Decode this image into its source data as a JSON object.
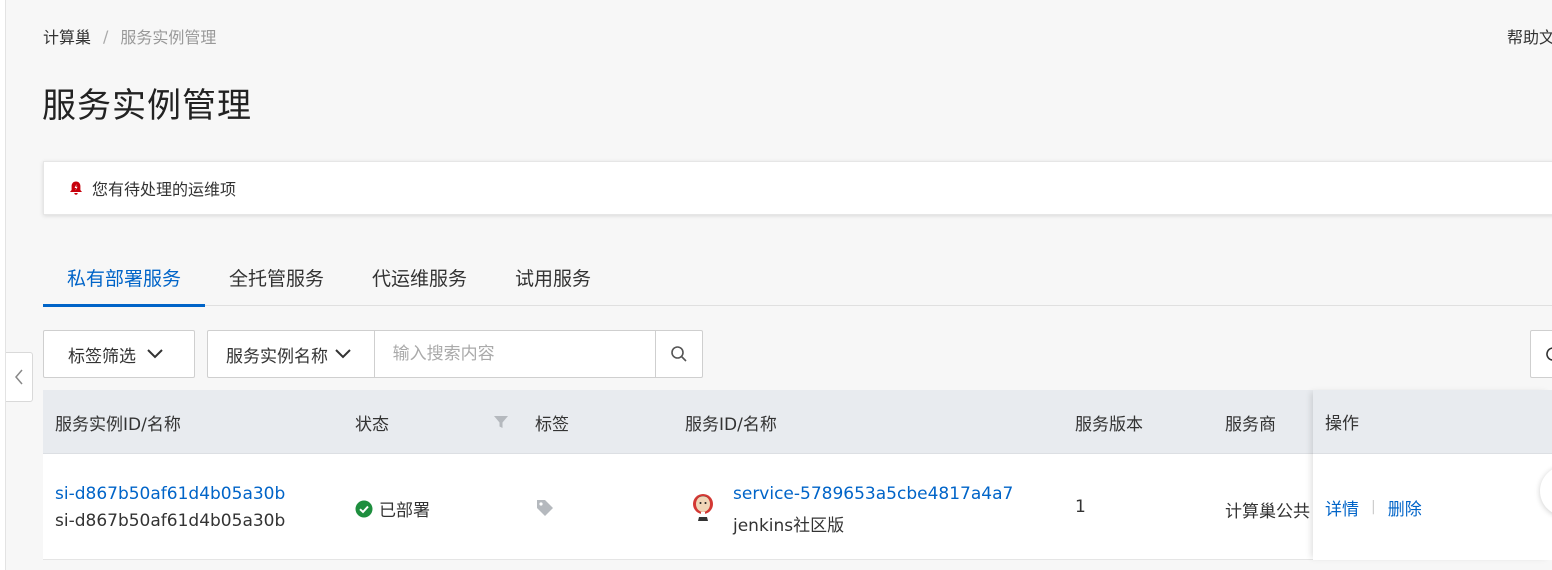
{
  "breadcrumb": {
    "root": "计算巢",
    "separator": "/",
    "current": "服务实例管理"
  },
  "header": {
    "help_text": "帮助文"
  },
  "page_title": "服务实例管理",
  "alert": {
    "text": "您有待处理的运维项",
    "icon": "bell-alert-icon",
    "icon_color": "#c7000b"
  },
  "tabs": [
    {
      "label": "私有部署服务",
      "active": true
    },
    {
      "label": "全托管服务",
      "active": false
    },
    {
      "label": "代运维服务",
      "active": false
    },
    {
      "label": "试用服务",
      "active": false
    }
  ],
  "toolbar": {
    "tag_filter_label": "标签筛选",
    "search_field_label": "服务实例名称",
    "search_placeholder": "输入搜索内容"
  },
  "table": {
    "columns": [
      "服务实例ID/名称",
      "状态",
      "标签",
      "服务ID/名称",
      "服务版本",
      "服务商",
      "操作"
    ],
    "rows": [
      {
        "instance_id": "si-d867b50af61d4b05a30b",
        "instance_name": "si-d867b50af61d4b05a30b",
        "status": "已部署",
        "status_color": "#1e8e3e",
        "service_id": "service-5789653a5cbe4817a4a7",
        "service_name": "jenkins社区版",
        "version": "1",
        "vendor": "计算巢公共",
        "action_detail": "详情",
        "action_delete": "删除"
      }
    ]
  },
  "colors": {
    "accent": "#0064c8",
    "header_bg": "#e8ebef",
    "page_bg": "#f7f7f7"
  }
}
